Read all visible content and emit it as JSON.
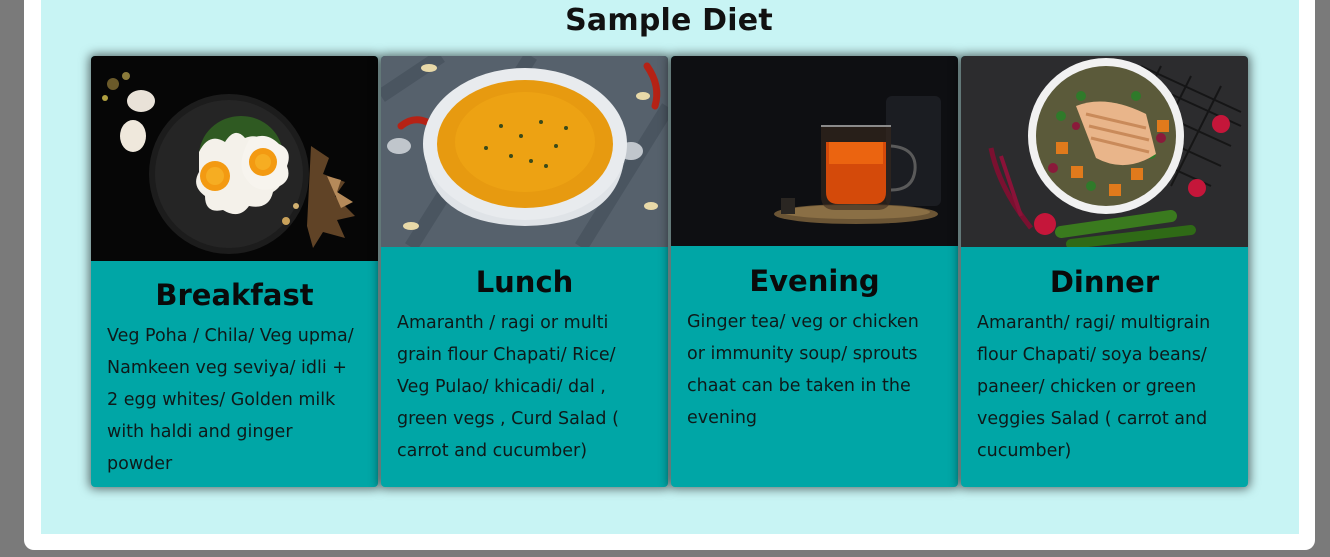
{
  "page": {
    "title": "Sample Diet"
  },
  "cards": [
    {
      "title": "Breakfast",
      "description": "Veg Poha / Chila/ Veg upma/ Namkeen veg seviya/ idli + 2 egg whites/ Golden milk with haldi and ginger powder",
      "image_icon": "fried-eggs-plate-image"
    },
    {
      "title": "Lunch",
      "description": "Amaranth / ragi or multi grain flour Chapati/ Rice/ Veg Pulao/ khicadi/ dal , green vegs , Curd Salad ( carrot and cucumber)",
      "image_icon": "soup-bowl-image"
    },
    {
      "title": "Evening",
      "description": "Ginger tea/ veg or chicken or immunity soup/ sprouts chaat can be taken in the evening",
      "image_icon": "tea-cup-image"
    },
    {
      "title": "Dinner",
      "description": "Amaranth/ ragi/ multigrain flour Chapati/ soya beans/ paneer/ chicken or green veggies Salad ( carrot and cucumber)",
      "image_icon": "salad-bowl-image"
    }
  ],
  "colors": {
    "panel_bg": "#c8f4f4",
    "card_bg": "#00a6a6",
    "outer_bg": "#7a7a7a"
  }
}
